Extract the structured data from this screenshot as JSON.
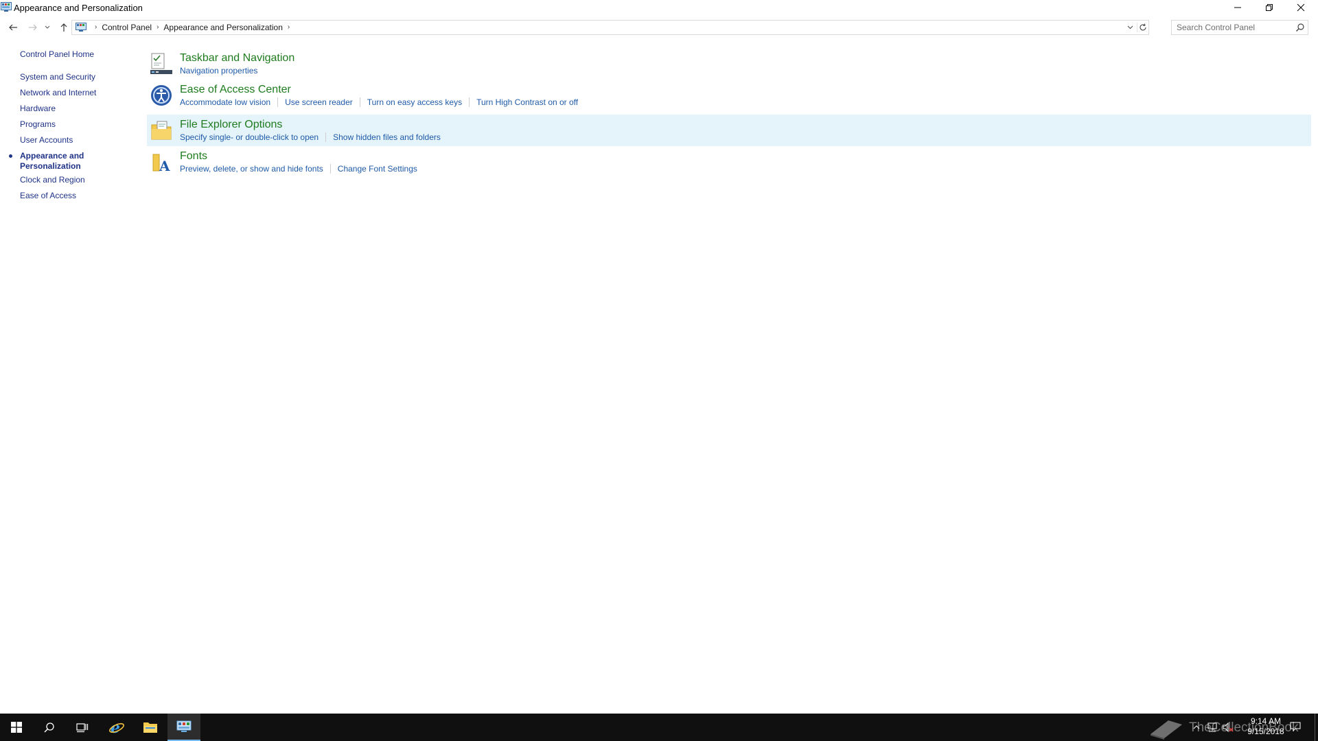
{
  "window": {
    "title": "Appearance and Personalization"
  },
  "address_bar": {
    "breadcrumbs": [
      "Control Panel",
      "Appearance and Personalization"
    ],
    "search_placeholder": "Search Control Panel"
  },
  "left_nav": {
    "home_label": "Control Panel Home",
    "categories": [
      {
        "label": "System and Security"
      },
      {
        "label": "Network and Internet"
      },
      {
        "label": "Hardware"
      },
      {
        "label": "Programs"
      },
      {
        "label": "User Accounts"
      },
      {
        "label": "Appearance and Personalization",
        "active": true
      },
      {
        "label": "Clock and Region"
      },
      {
        "label": "Ease of Access"
      }
    ]
  },
  "main": {
    "items": [
      {
        "title": "Taskbar and Navigation",
        "icon": "taskbar-icon",
        "links": [
          "Navigation properties"
        ]
      },
      {
        "title": "Ease of Access Center",
        "icon": "ease-of-access-icon",
        "links": [
          "Accommodate low vision",
          "Use screen reader",
          "Turn on easy access keys",
          "Turn High Contrast on or off"
        ]
      },
      {
        "title": "File Explorer Options",
        "icon": "folder-options-icon",
        "highlighted": true,
        "links": [
          "Specify single- or double-click to open",
          "Show hidden files and folders"
        ]
      },
      {
        "title": "Fonts",
        "icon": "fonts-folder-icon",
        "links": [
          "Preview, delete, or show and hide fonts",
          "Change Font Settings"
        ]
      }
    ]
  },
  "taskbar": {
    "time": "9:14 AM",
    "date": "9/15/2018",
    "watermark": "TheCollectionBook",
    "accent_color": "#76b9ed"
  },
  "colors": {
    "link_blue": "#1e5aa8",
    "heading_green": "#1e7c1e",
    "nav_blue": "#1e3287",
    "highlight": "#e5f3fb"
  }
}
